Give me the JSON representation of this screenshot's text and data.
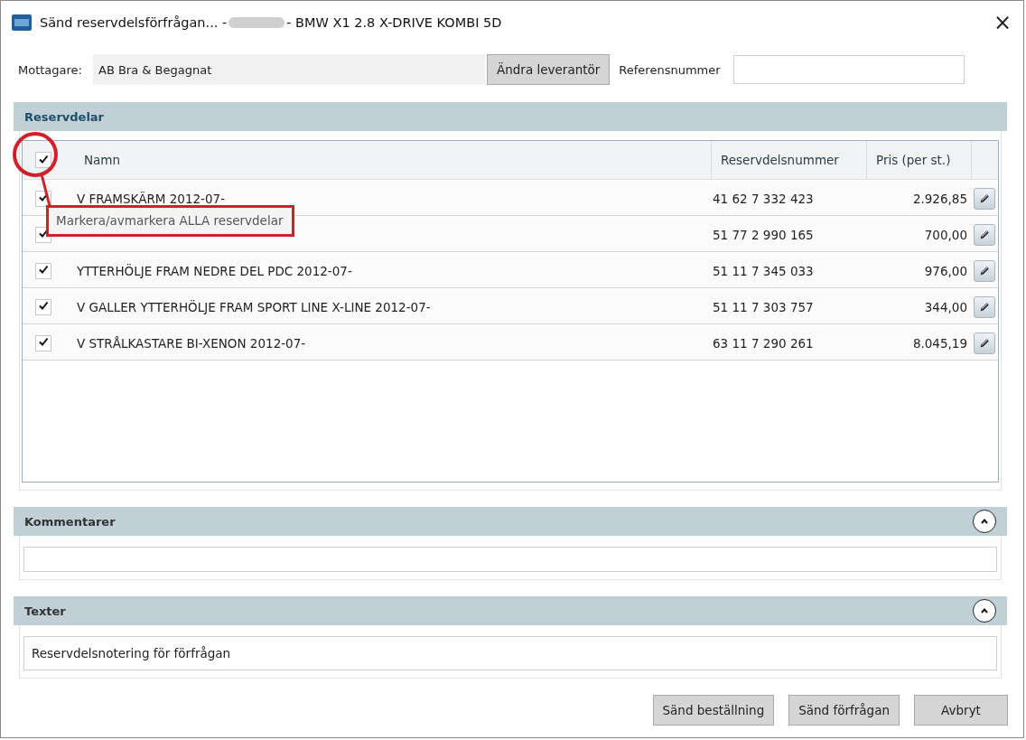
{
  "window": {
    "title_prefix": "Sänd reservdelsförfrågan... -",
    "title_suffix": "- BMW X1 2.8 X-DRIVE KOMBI 5D",
    "close": "×"
  },
  "recipient": {
    "label": "Mottagare:",
    "value": "AB Bra & Begagnat",
    "change_button": "Ändra leverantör",
    "reference_label": "Referensnummer"
  },
  "parts": {
    "heading": "Reservdelar",
    "table": {
      "select_all_checked": true,
      "columns": [
        "Namn",
        "Reservdelsnummer",
        "Pris (per st.)"
      ],
      "rows": [
        {
          "checked": true,
          "name": "V FRAMSKÄRM 2012-07-",
          "number": "41 62 7 332 423",
          "price": "2.926,85"
        },
        {
          "checked": true,
          "number": "51 77 2 990 165",
          "price": "700,00"
        },
        {
          "checked": true,
          "name": "YTTERHÖLJE FRAM NEDRE DEL PDC 2012-07-",
          "number": "51 11 7 345 033",
          "price": "976,00"
        },
        {
          "checked": true,
          "name": "V GALLER YTTERHÖLJE FRAM SPORT LINE X-LINE 2012-07-",
          "number": "51 11 7 303 757",
          "price": "344,00"
        },
        {
          "checked": true,
          "name": "V STRÅLKASTARE BI-XENON 2012-07-",
          "number": "63 11 7 290 261",
          "price": "8.045,19"
        }
      ]
    },
    "tooltip": "Markera/avmarkera ALLA reservdelar"
  },
  "comments": {
    "heading": "Kommentarer",
    "expanded": true
  },
  "texts": {
    "heading": "Texter",
    "expanded": true,
    "value": "Reservdelsnotering för förfrågan"
  },
  "buttons": [
    "Sänd beställning",
    "Sänd förfrågan",
    "Avbryt"
  ]
}
